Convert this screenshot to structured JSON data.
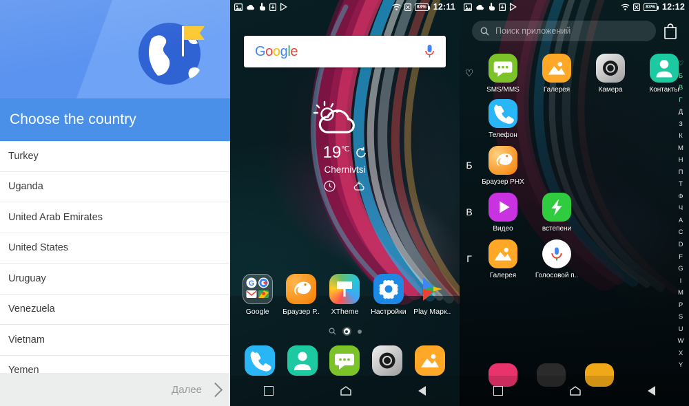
{
  "panel_country": {
    "name": "country-chooser",
    "title": "Choose the country",
    "hero_icon": "globe-with-flag-icon",
    "countries": [
      "Turkey",
      "Uganda",
      "United Arab Emirates",
      "United States",
      "Uruguay",
      "Venezuela",
      "Vietnam",
      "Yemen"
    ],
    "next_label": "Далее",
    "next_icon": "chevron-right-icon",
    "colors": {
      "header": "#4a90e8",
      "hero": "#5b93f0",
      "footer": "#eceded",
      "flag": "#fcc934"
    }
  },
  "panel_home": {
    "name": "android-homescreen",
    "statusbar": {
      "left_icons": [
        "screenshot-icon",
        "cloud-icon",
        "touch-icon",
        "download-icon",
        "play-icon"
      ],
      "right_icons": [
        "wifi-icon",
        "no-sim-icon"
      ],
      "battery": "83%",
      "time": "12:11"
    },
    "search_widget": {
      "logo": "Google",
      "logo_letters": [
        "G",
        "o",
        "o",
        "g",
        "l",
        "e"
      ],
      "logo_colors": [
        "#4285f4",
        "#ea4335",
        "#fbbc05",
        "#4285f4",
        "#34a853",
        "#ea4335"
      ],
      "mic_icon": "microphone-icon"
    },
    "weather": {
      "condition_icon": "sun-behind-cloud-icon",
      "temperature": "19",
      "unit": "℃",
      "refresh_icon": "refresh-icon",
      "city": "Chernivtsi",
      "sub_icons": [
        "clock-icon",
        "cloud-icon"
      ]
    },
    "apps": [
      {
        "label": "Google",
        "icon": "google-folder-icon"
      },
      {
        "label": "Браузер Р..",
        "icon": "phoenix-browser-icon"
      },
      {
        "label": "XTheme",
        "icon": "xtheme-icon"
      },
      {
        "label": "Настройки",
        "icon": "settings-gear-icon"
      },
      {
        "label": "Play Марк..",
        "icon": "play-store-icon"
      }
    ],
    "page_indicator": {
      "search_dot": "search-icon",
      "pages": 2,
      "active": 1
    },
    "dock": [
      {
        "label": "Телефон",
        "icon": "phone-icon"
      },
      {
        "label": "Контакты",
        "icon": "contacts-icon"
      },
      {
        "label": "SMS/MMS",
        "icon": "message-icon"
      },
      {
        "label": "Камера",
        "icon": "camera-icon"
      },
      {
        "label": "Галерея",
        "icon": "gallery-icon"
      }
    ],
    "navbar": [
      "recents-square-icon",
      "home-icon",
      "back-icon"
    ]
  },
  "panel_drawer": {
    "name": "app-drawer",
    "statusbar": {
      "left_icons": [
        "screenshot-icon",
        "cloud-icon",
        "touch-icon",
        "download-icon",
        "play-icon"
      ],
      "right_icons": [
        "wifi-icon",
        "no-sim-icon"
      ],
      "battery": "83%",
      "time": "12:12"
    },
    "search": {
      "icon": "search-icon",
      "placeholder": "Поиск приложений",
      "value": "",
      "store_icon": "shopping-bag-icon"
    },
    "sections": [
      {
        "letter": "♡",
        "apps": [
          {
            "label": "SMS/MMS",
            "icon": "message-icon"
          },
          {
            "label": "Галерея",
            "icon": "gallery-icon"
          },
          {
            "label": "Камера",
            "icon": "camera-icon"
          },
          {
            "label": "Контакты",
            "icon": "contacts-icon"
          }
        ]
      },
      {
        "letter": "",
        "apps": [
          {
            "label": "Телефон",
            "icon": "phone-icon"
          }
        ]
      },
      {
        "letter": "Б",
        "apps": [
          {
            "label": "Браузер PHX",
            "icon": "phoenix-browser-icon"
          }
        ]
      },
      {
        "letter": "В",
        "apps": [
          {
            "label": "Видео",
            "icon": "video-player-icon"
          },
          {
            "label": "встепени",
            "icon": "lightning-icon"
          }
        ]
      },
      {
        "letter": "Г",
        "apps": [
          {
            "label": "Галерея",
            "icon": "gallery-icon"
          },
          {
            "label": "Голосовой п..",
            "icon": "voice-search-icon"
          }
        ]
      }
    ],
    "alpha_index": [
      "♡",
      "Б",
      "В",
      "Г",
      "Д",
      "З",
      "К",
      "М",
      "Н",
      "П",
      "Т",
      "Ф",
      "Ч",
      "A",
      "C",
      "D",
      "F",
      "G",
      "I",
      "M",
      "P",
      "S",
      "U",
      "W",
      "X",
      "Y"
    ],
    "alpha_highlighted": [
      "♡",
      "Б",
      "В",
      "Г"
    ],
    "navbar": [
      "recents-square-icon",
      "home-icon",
      "back-icon"
    ]
  }
}
